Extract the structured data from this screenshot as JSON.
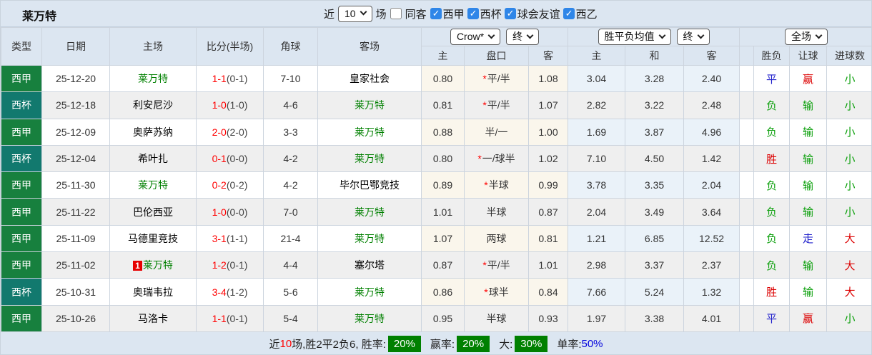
{
  "title": "莱万特",
  "toolbar": {
    "recent_label": "近",
    "recent_value": "10",
    "games_label": "场",
    "same_away_label": "同客",
    "same_away_checked": false,
    "filters": [
      {
        "label": "西甲",
        "checked": true
      },
      {
        "label": "西杯",
        "checked": true
      },
      {
        "label": "球会友谊",
        "checked": true
      },
      {
        "label": "西乙",
        "checked": true
      }
    ]
  },
  "header": {
    "cols": [
      "类型",
      "日期",
      "主场",
      "比分(半场)",
      "角球",
      "客场"
    ],
    "handicap_company_select": "Crow*",
    "handicap_time_select": "终",
    "avg_select": "胜平负均值",
    "avg_time_select": "终",
    "scope_select": "全场",
    "handicap_subcols": [
      "主",
      "盘口",
      "客"
    ],
    "avg_subcols": [
      "主",
      "和",
      "客"
    ],
    "result_cols": [
      "胜负",
      "让球",
      "进球数"
    ]
  },
  "colors": {
    "league": {
      "西甲": "#17803e",
      "西杯": "#12796e"
    },
    "team_focus": "#008000",
    "result": {
      "胜": "#dc0000",
      "赢": "#dc0000",
      "大": "#dc0000",
      "平": "#2121cc",
      "走": "#2121cc",
      "负": "#0ca00c",
      "输": "#0ca00c",
      "小": "#0ca00c"
    }
  },
  "rows": [
    {
      "league": "西甲",
      "date": "25-12-20",
      "home": "莱万特",
      "home_focus": true,
      "home_badge": "",
      "score": "1-1",
      "half": "(0-1)",
      "corners": "7-10",
      "away": "皇家社会",
      "away_focus": false,
      "ah_home": "0.80",
      "ah_star": true,
      "ah_line": "平/半",
      "ah_away": "1.08",
      "avg_home": "3.04",
      "avg_draw": "3.28",
      "avg_away": "2.40",
      "wdl": "平",
      "hres": "赢",
      "gres": "小"
    },
    {
      "league": "西杯",
      "date": "25-12-18",
      "home": "利安尼沙",
      "home_focus": false,
      "home_badge": "",
      "score": "1-0",
      "half": "(1-0)",
      "corners": "4-6",
      "away": "莱万特",
      "away_focus": true,
      "ah_home": "0.81",
      "ah_star": true,
      "ah_line": "平/半",
      "ah_away": "1.07",
      "avg_home": "2.82",
      "avg_draw": "3.22",
      "avg_away": "2.48",
      "wdl": "负",
      "hres": "输",
      "gres": "小"
    },
    {
      "league": "西甲",
      "date": "25-12-09",
      "home": "奥萨苏纳",
      "home_focus": false,
      "home_badge": "",
      "score": "2-0",
      "half": "(2-0)",
      "corners": "3-3",
      "away": "莱万特",
      "away_focus": true,
      "ah_home": "0.88",
      "ah_star": false,
      "ah_line": "半/一",
      "ah_away": "1.00",
      "avg_home": "1.69",
      "avg_draw": "3.87",
      "avg_away": "4.96",
      "wdl": "负",
      "hres": "输",
      "gres": "小"
    },
    {
      "league": "西杯",
      "date": "25-12-04",
      "home": "希叶扎",
      "home_focus": false,
      "home_badge": "",
      "score": "0-1",
      "half": "(0-0)",
      "corners": "4-2",
      "away": "莱万特",
      "away_focus": true,
      "ah_home": "0.80",
      "ah_star": true,
      "ah_line": "一/球半",
      "ah_away": "1.02",
      "avg_home": "7.10",
      "avg_draw": "4.50",
      "avg_away": "1.42",
      "wdl": "胜",
      "hres": "输",
      "gres": "小"
    },
    {
      "league": "西甲",
      "date": "25-11-30",
      "home": "莱万特",
      "home_focus": true,
      "home_badge": "",
      "score": "0-2",
      "half": "(0-2)",
      "corners": "4-2",
      "away": "毕尔巴鄂竞技",
      "away_focus": false,
      "ah_home": "0.89",
      "ah_star": true,
      "ah_line": "半球",
      "ah_away": "0.99",
      "avg_home": "3.78",
      "avg_draw": "3.35",
      "avg_away": "2.04",
      "wdl": "负",
      "hres": "输",
      "gres": "小"
    },
    {
      "league": "西甲",
      "date": "25-11-22",
      "home": "巴伦西亚",
      "home_focus": false,
      "home_badge": "",
      "score": "1-0",
      "half": "(0-0)",
      "corners": "7-0",
      "away": "莱万特",
      "away_focus": true,
      "ah_home": "1.01",
      "ah_star": false,
      "ah_line": "半球",
      "ah_away": "0.87",
      "avg_home": "2.04",
      "avg_draw": "3.49",
      "avg_away": "3.64",
      "wdl": "负",
      "hres": "输",
      "gres": "小"
    },
    {
      "league": "西甲",
      "date": "25-11-09",
      "home": "马德里竞技",
      "home_focus": false,
      "home_badge": "",
      "score": "3-1",
      "half": "(1-1)",
      "corners": "21-4",
      "away": "莱万特",
      "away_focus": true,
      "ah_home": "1.07",
      "ah_star": false,
      "ah_line": "两球",
      "ah_away": "0.81",
      "avg_home": "1.21",
      "avg_draw": "6.85",
      "avg_away": "12.52",
      "wdl": "负",
      "hres": "走",
      "gres": "大"
    },
    {
      "league": "西甲",
      "date": "25-11-02",
      "home": "莱万特",
      "home_focus": true,
      "home_badge": "1",
      "score": "1-2",
      "half": "(0-1)",
      "corners": "4-4",
      "away": "塞尔塔",
      "away_focus": false,
      "ah_home": "0.87",
      "ah_star": true,
      "ah_line": "平/半",
      "ah_away": "1.01",
      "avg_home": "2.98",
      "avg_draw": "3.37",
      "avg_away": "2.37",
      "wdl": "负",
      "hres": "输",
      "gres": "大"
    },
    {
      "league": "西杯",
      "date": "25-10-31",
      "home": "奥瑞韦拉",
      "home_focus": false,
      "home_badge": "",
      "score": "3-4",
      "half": "(1-2)",
      "corners": "5-6",
      "away": "莱万特",
      "away_focus": true,
      "ah_home": "0.86",
      "ah_star": true,
      "ah_line": "球半",
      "ah_away": "0.84",
      "avg_home": "7.66",
      "avg_draw": "5.24",
      "avg_away": "1.32",
      "wdl": "胜",
      "hres": "输",
      "gres": "大"
    },
    {
      "league": "西甲",
      "date": "25-10-26",
      "home": "马洛卡",
      "home_focus": false,
      "home_badge": "",
      "score": "1-1",
      "half": "(0-1)",
      "corners": "5-4",
      "away": "莱万特",
      "away_focus": true,
      "ah_home": "0.95",
      "ah_star": false,
      "ah_line": "半球",
      "ah_away": "0.93",
      "avg_home": "1.97",
      "avg_draw": "3.38",
      "avg_away": "4.01",
      "wdl": "平",
      "hres": "赢",
      "gres": "小"
    }
  ],
  "summary": {
    "prefix": "近",
    "count": "10",
    "middle": "场,胜2平2负6, 胜率:",
    "win_rate": "20%",
    "handicap_label": "赢率:",
    "handicap_rate": "20%",
    "big_label": "大:",
    "big_rate": "30%",
    "single_label": "单率:",
    "single_rate": "50%"
  }
}
